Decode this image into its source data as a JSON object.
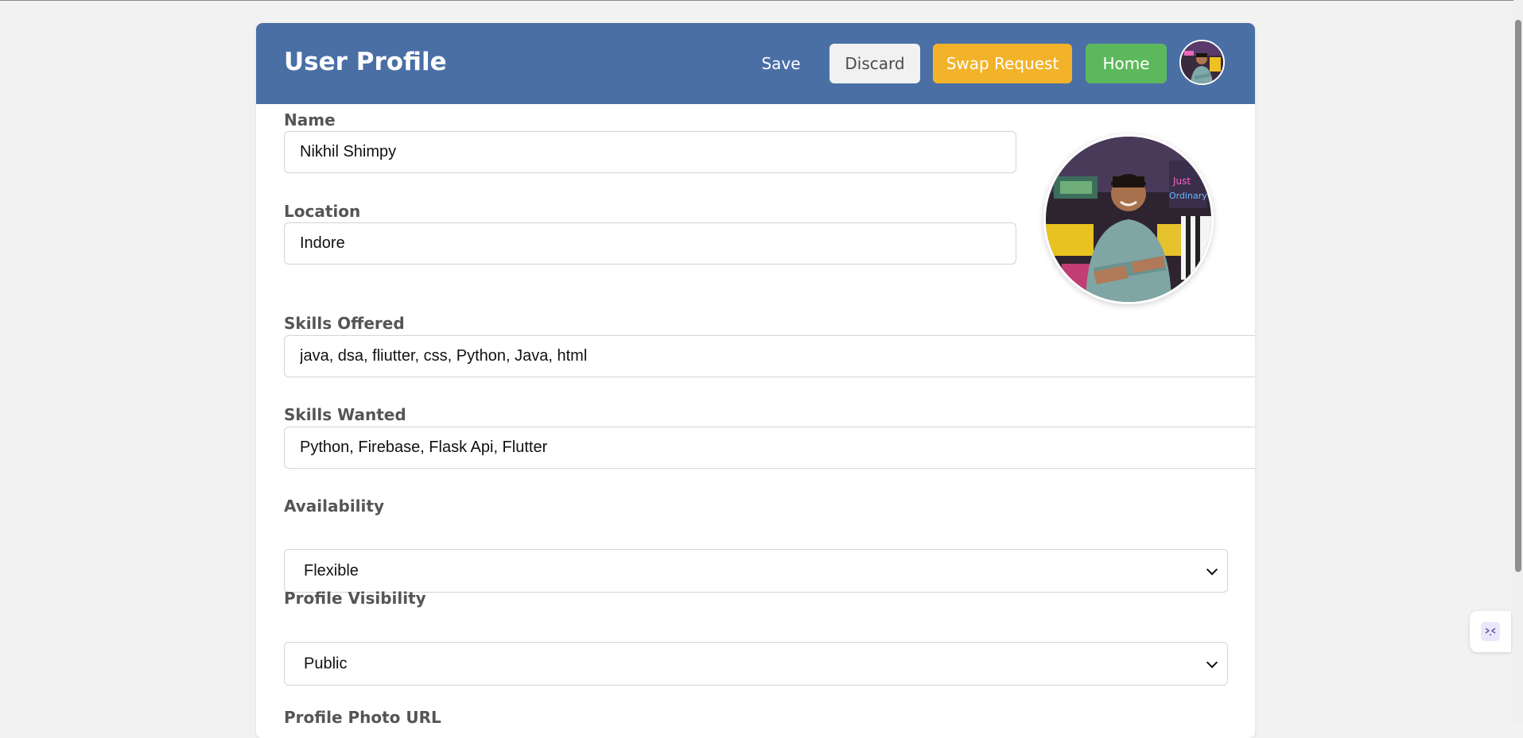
{
  "header": {
    "title": "User Profile",
    "buttons": {
      "save": "Save",
      "discard": "Discard",
      "swap_request": "Swap Request",
      "home": "Home"
    }
  },
  "form": {
    "name": {
      "label": "Name",
      "value": "Nikhil Shimpy"
    },
    "location": {
      "label": "Location",
      "value": "Indore"
    },
    "skills_offered": {
      "label": "Skills Offered",
      "value": "java, dsa, fliutter, css, Python, Java, html"
    },
    "skills_wanted": {
      "label": "Skills Wanted",
      "value": "Python, Firebase, Flask Api, Flutter"
    },
    "availability": {
      "label": "Availability",
      "value": "Flexible"
    },
    "profile_visibility": {
      "label": "Profile Visibility",
      "value": "Public"
    },
    "profile_photo_url": {
      "label": "Profile Photo URL"
    }
  },
  "colors": {
    "header_bg": "#4a6fa5",
    "discard_bg": "#f1f1f2",
    "swap_bg": "#f2b32a",
    "home_bg": "#5cb85c",
    "page_bg": "#f2f2f2"
  },
  "icons": {
    "header_avatar": "user-avatar",
    "profile_photo": "profile-photo",
    "select_chevron": "chevron-down-icon",
    "side_tab": "code-icon"
  }
}
